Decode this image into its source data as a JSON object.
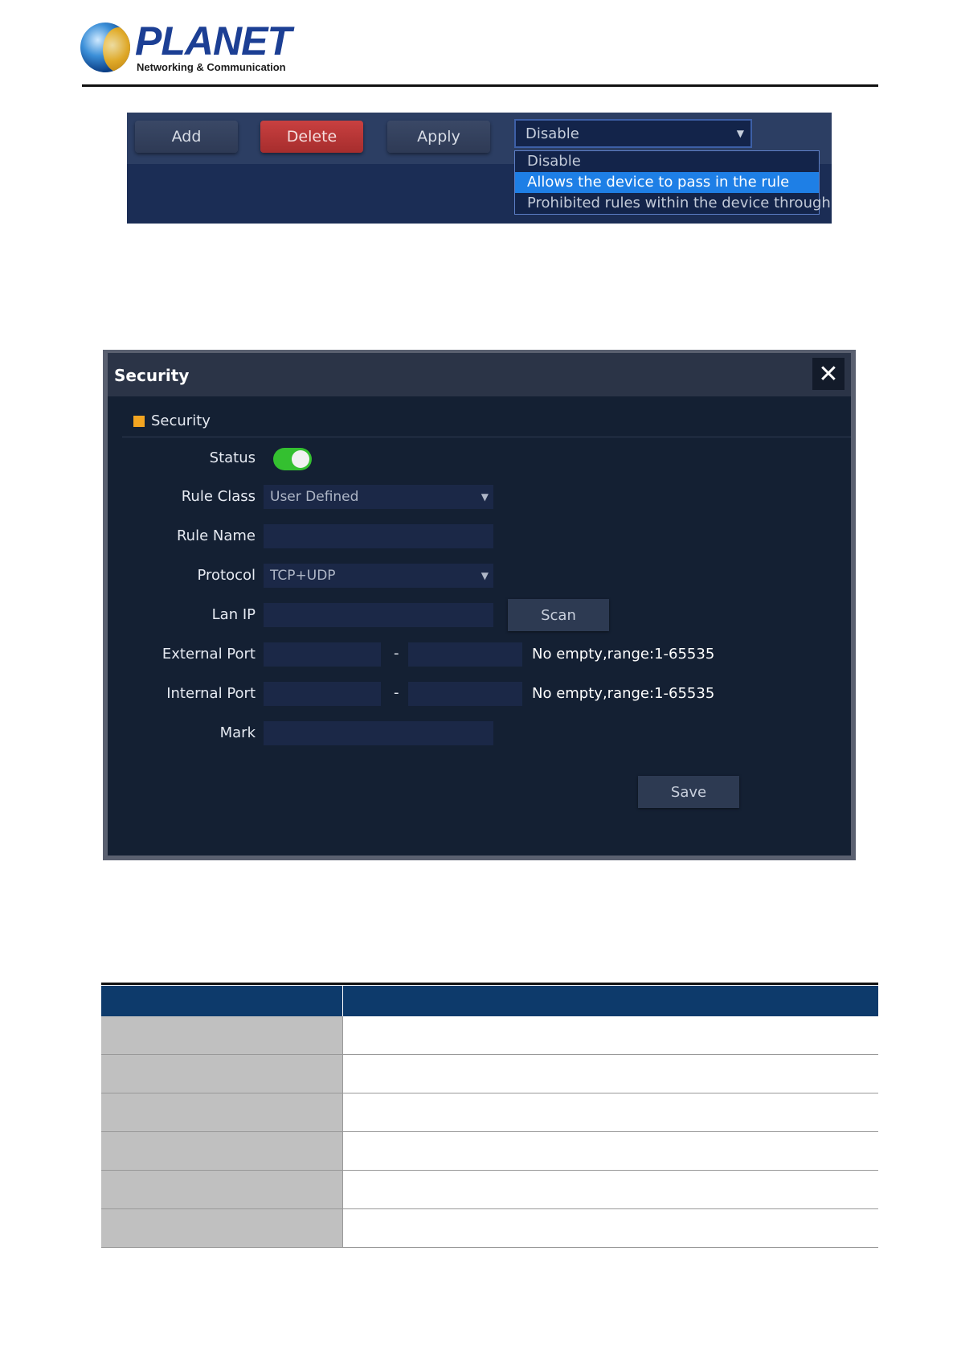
{
  "header": {
    "brand_name": "PLANET",
    "brand_tagline": "Networking & Communication"
  },
  "toolbar": {
    "add_label": "Add",
    "delete_label": "Delete",
    "apply_label": "Apply",
    "mode_select": {
      "value": "Disable",
      "options": [
        "Disable",
        "Allows the device to pass in the rule",
        "Prohibited rules within the device through"
      ],
      "highlighted_index": 1
    }
  },
  "dialog": {
    "title": "Security",
    "close_icon": "close-icon",
    "section_label": "Security",
    "status_label": "Status",
    "status_on": true,
    "rule_class_label": "Rule Class",
    "rule_class_value": "User Defined",
    "rule_name_label": "Rule Name",
    "rule_name_value": "",
    "protocol_label": "Protocol",
    "protocol_value": "TCP+UDP",
    "lan_ip_label": "Lan IP",
    "lan_ip_value": "",
    "scan_label": "Scan",
    "external_port_label": "External Port",
    "internal_port_label": "Internal Port",
    "port_separator": "-",
    "port_hint": "No empty,range:1-65535",
    "mark_label": "Mark",
    "mark_value": "",
    "save_label": "Save"
  },
  "colors": {
    "delete_button": "#c94040",
    "toggle_on": "#34c030",
    "section_marker": "#f3a521",
    "dropdown_highlight": "#1e7fe6",
    "table_header": "#0d3a6b"
  }
}
